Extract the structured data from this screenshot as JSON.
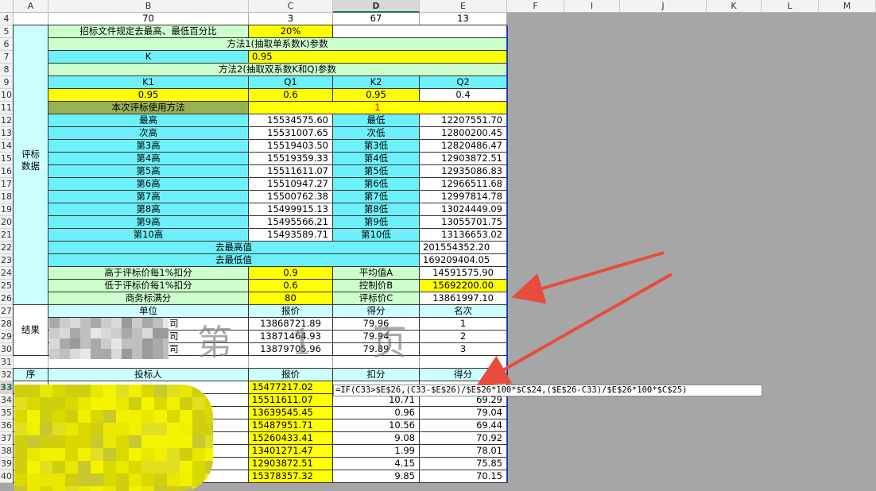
{
  "columns": [
    "A",
    "B",
    "C",
    "D",
    "E",
    "F",
    "I",
    "J",
    "K",
    "L",
    "M"
  ],
  "selected_column": "D",
  "selected_row": "33",
  "rows": [
    "4",
    "5",
    "6",
    "7",
    "8",
    "9",
    "10",
    "11",
    "12",
    "13",
    "14",
    "15",
    "16",
    "17",
    "18",
    "19",
    "20",
    "21",
    "22",
    "23",
    "24",
    "25",
    "26",
    "27",
    "28",
    "29",
    "30",
    "31",
    "32",
    "33",
    "34",
    "35",
    "36",
    "37",
    "38",
    "39",
    "40"
  ],
  "row4": {
    "b": "70",
    "c": "3",
    "d": "67",
    "e": "13"
  },
  "p5": {
    "label": "招标文件规定去最高、最低百分比",
    "value": "20%"
  },
  "p6": {
    "label": "方法1(抽取单系数K)参数"
  },
  "p7": {
    "label": "K",
    "value": "0.95"
  },
  "p8": {
    "label": "方法2(抽取双系数K和Q)参数"
  },
  "p9": {
    "k1": "K1",
    "q1": "Q1",
    "k2": "K2",
    "q2": "Q2"
  },
  "p10": {
    "k1": "0.95",
    "q1": "0.6",
    "k2": "0.95",
    "q2": "0.4"
  },
  "p11": {
    "label": "本次评标使用方法",
    "value": "1"
  },
  "a_label": "评标\n数据",
  "bids": [
    {
      "hl": "最高",
      "hv": "15534575.60",
      "ll": "最低",
      "lv": "12207551.70"
    },
    {
      "hl": "次高",
      "hv": "15531007.65",
      "ll": "次低",
      "lv": "12800200.45"
    },
    {
      "hl": "第3高",
      "hv": "15519403.50",
      "ll": "第3低",
      "lv": "12820486.47"
    },
    {
      "hl": "第4高",
      "hv": "15519359.33",
      "ll": "第4低",
      "lv": "12903872.51"
    },
    {
      "hl": "第5高",
      "hv": "15511611.07",
      "ll": "第5低",
      "lv": "12935086.83"
    },
    {
      "hl": "第6高",
      "hv": "15510947.27",
      "ll": "第6低",
      "lv": "12966511.68"
    },
    {
      "hl": "第7高",
      "hv": "15500762.38",
      "ll": "第7低",
      "lv": "12997814.78"
    },
    {
      "hl": "第8高",
      "hv": "15499915.13",
      "ll": "第8低",
      "lv": "13024449.09"
    },
    {
      "hl": "第9高",
      "hv": "15495566.21",
      "ll": "第9低",
      "lv": "13055701.75"
    },
    {
      "hl": "第10高",
      "hv": "15493589.71",
      "ll": "第10低",
      "lv": "13136653.02"
    }
  ],
  "r22": {
    "label": "去最高值",
    "value": "201554352.20"
  },
  "r23": {
    "label": "去最低值",
    "value": "169209404.05"
  },
  "r24": {
    "label": "高于评标价每1%扣分",
    "value": "0.9",
    "dlabel": "平均值A",
    "evalue": "14591575.90"
  },
  "r25": {
    "label": "低于评标价每1%扣分",
    "value": "0.6",
    "dlabel": "控制价B",
    "evalue": "15692200.00"
  },
  "r26": {
    "label": "商务标满分",
    "value": "80",
    "dlabel": "评标价C",
    "evalue": "13861997.10"
  },
  "result": {
    "a_label": "结果",
    "header": {
      "b": "单位",
      "c": "报价",
      "d": "得分",
      "e": "名次"
    },
    "rows": [
      {
        "b": "司",
        "c": "13868721.89",
        "d": "79.96",
        "e": "1"
      },
      {
        "b": "司",
        "c": "13871464.93",
        "d": "79.94",
        "e": "2"
      },
      {
        "b": "司",
        "c": "13879705.96",
        "d": "79.89",
        "e": "3"
      }
    ]
  },
  "table2": {
    "header": {
      "a": "序",
      "b": "投标人",
      "c": "报价",
      "d": "扣分",
      "e": "得分"
    },
    "rows": [
      {
        "c": "15477217.02",
        "d": "",
        "e": ""
      },
      {
        "c": "15511611.07",
        "d": "10.71",
        "e": "69.29"
      },
      {
        "c": "13639545.45",
        "d": "0.96",
        "e": "79.04"
      },
      {
        "c": "15487951.71",
        "d": "10.56",
        "e": "69.44"
      },
      {
        "c": "15260433.41",
        "d": "9.08",
        "e": "70.92"
      },
      {
        "c": "13401271.47",
        "d": "1.99",
        "e": "78.01"
      },
      {
        "c": "12903872.51",
        "d": "4.15",
        "e": "75.85"
      },
      {
        "c": "15378357.32",
        "d": "9.85",
        "e": "70.15"
      }
    ]
  },
  "formula": "=IF(C33>$E$26,(C33-$E$26)/$E$26*100*$C$24,($E$26-C33)/$E$26*100*$C$25)",
  "watermark": "第 1 页",
  "colors": {
    "cyan": "#6ef0fb",
    "yellow": "#ffff00",
    "lightgreen": "#ccffcc",
    "olive": "#98b155",
    "pale": "#ccffff",
    "arrow": "#e84c3d",
    "gray": "#a6a6a6"
  }
}
